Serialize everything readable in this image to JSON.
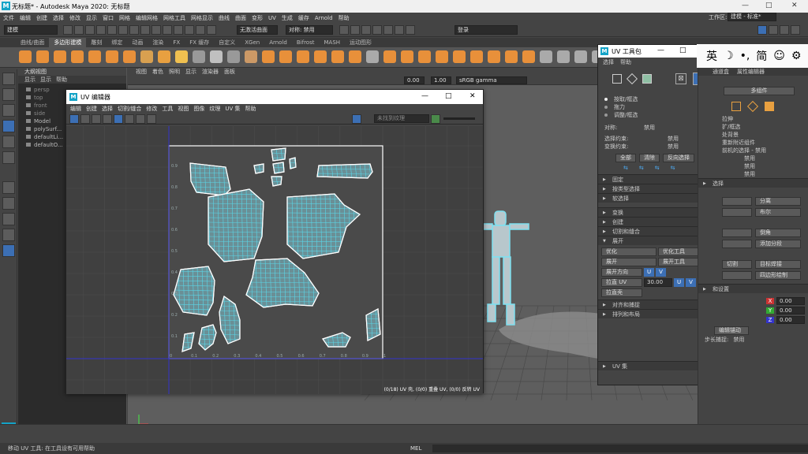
{
  "titlebar": {
    "title": "无标题* - Autodesk Maya 2020: 无标题",
    "logo": "M",
    "minimize": "—",
    "maximize": "□",
    "close": "✕"
  },
  "menubar": {
    "items": [
      "文件",
      "编辑",
      "创建",
      "选择",
      "修改",
      "显示",
      "窗口",
      "网格",
      "编辑网格",
      "网格工具",
      "网格显示",
      "曲线",
      "曲面",
      "变形",
      "UV",
      "生成",
      "缓存",
      "Arnold",
      "帮助"
    ],
    "workspace_label": "工作区:",
    "workspace_value": "建模 - 标准*"
  },
  "statusline": {
    "mode": "建模",
    "no_live": "无激活曲面",
    "symmetry": "对称: 禁用",
    "login": "登录"
  },
  "shelf": {
    "tabs": [
      "曲线/曲面",
      "多边形建模",
      "雕刻",
      "绑定",
      "动画",
      "渲染",
      "FX",
      "FX 缓存",
      "自定义",
      "XGen",
      "Arnold",
      "Bifrost",
      "MASH",
      "运动图形"
    ],
    "active": "多边形建模"
  },
  "outliner": {
    "title": "大纲视图",
    "menu": [
      "显示",
      "显示",
      "帮助"
    ],
    "items": [
      {
        "name": "persp",
        "cam": true
      },
      {
        "name": "top",
        "cam": true
      },
      {
        "name": "front",
        "cam": true
      },
      {
        "name": "side",
        "cam": true
      },
      {
        "name": "Model",
        "cam": false
      },
      {
        "name": "polySurf...",
        "cam": false
      },
      {
        "name": "defaultLi...",
        "cam": false
      },
      {
        "name": "defaultO...",
        "cam": false
      }
    ]
  },
  "viewport": {
    "menu": [
      "视图",
      "着色",
      "照明",
      "显示",
      "渲染器",
      "面板"
    ],
    "exposure": "0.00",
    "gamma": "1.00",
    "colorspace": "sRGB gamma",
    "camera": "persp"
  },
  "uv_editor": {
    "title": "UV 编辑器",
    "menu": [
      "编辑",
      "创建",
      "选择",
      "切割/缝合",
      "修改",
      "工具",
      "视图",
      "图像",
      "纹理",
      "UV 集",
      "帮助"
    ],
    "texture_placeholder": "未找到纹理",
    "status": "(0/18) UV 壳, (0/0) 重叠 UV, (0/0) 反转 UV",
    "ruler_y": [
      "0.9",
      "0.8",
      "0.7",
      "0.6",
      "0.5",
      "0.4",
      "0.3",
      "0.2",
      "0.1"
    ],
    "ruler_x": [
      "0",
      "0.1",
      "0.2",
      "0.3",
      "0.4",
      "0.5",
      "0.6",
      "0.7",
      "0.8",
      "0.9",
      "1"
    ]
  },
  "uv_toolkit": {
    "title": "UV 工具包",
    "menu": [
      "选择",
      "帮助"
    ],
    "radio": [
      "按取/框选",
      "拖力",
      "调整/框选"
    ],
    "symmetry_label": "对称:",
    "symmetry_value": "禁用",
    "sel_constraint_label": "选择约束:",
    "sel_constraint_value": "禁用",
    "transform_constraint_label": "变换约束:",
    "transform_constraint_value": "禁用",
    "buttons": [
      "全部",
      "清除",
      "反向选择"
    ],
    "sections": [
      "固定",
      "按类型选择",
      "软选择",
      "变换",
      "创建",
      "切割和缝合",
      "展开"
    ],
    "unfold": {
      "optimize": "优化",
      "optimize_tool": "优化工具",
      "unfold": "展开",
      "unfold_tool": "展开工具",
      "unfold_dir": "展开方向",
      "straighten_uv": "拉直 UV",
      "straighten_value": "30.00",
      "straighten_shell": "拉直壳",
      "u": "U",
      "v": "V"
    },
    "sections2": [
      "对齐和捕捉",
      "排列和布局"
    ],
    "uvset": "UV 集"
  },
  "ime": {
    "chars": [
      "英",
      "☽",
      "•,",
      "简",
      "☺",
      "⚙"
    ]
  },
  "attribute_editor": {
    "tabs": [
      "通道盒",
      "属性编辑器"
    ],
    "multi": "多组件",
    "rows": [
      "拉伸",
      "扩/框选",
      "处背景",
      "重新附近组件",
      "前机的选择 - 禁用",
      "禁用",
      "禁用",
      "禁用"
    ],
    "sec_select": "选择",
    "split": "分离",
    "cut": "切割",
    "sew": "布尔",
    "smooth": "倒角",
    "add_split": "添加分段",
    "target_weld": "目标焊接",
    "quad_draw": "四边形绘制",
    "settings": "和设置",
    "edit_anchor": "编辑锚动",
    "step_snap_label": "步长捕捉:",
    "step_snap_value": "禁用",
    "xyz": [
      "X",
      "Y",
      "Z"
    ],
    "xyz_values": [
      "0.00",
      "0.00",
      "0.00"
    ]
  },
  "helpline": {
    "text": "移动 UV 工具: 在工具设有可用帮助",
    "mel": "MEL"
  },
  "colors": {
    "uv_line": "#5ad7e8",
    "uv_face": "#6a8f96",
    "accent": "#3c6fb4"
  }
}
